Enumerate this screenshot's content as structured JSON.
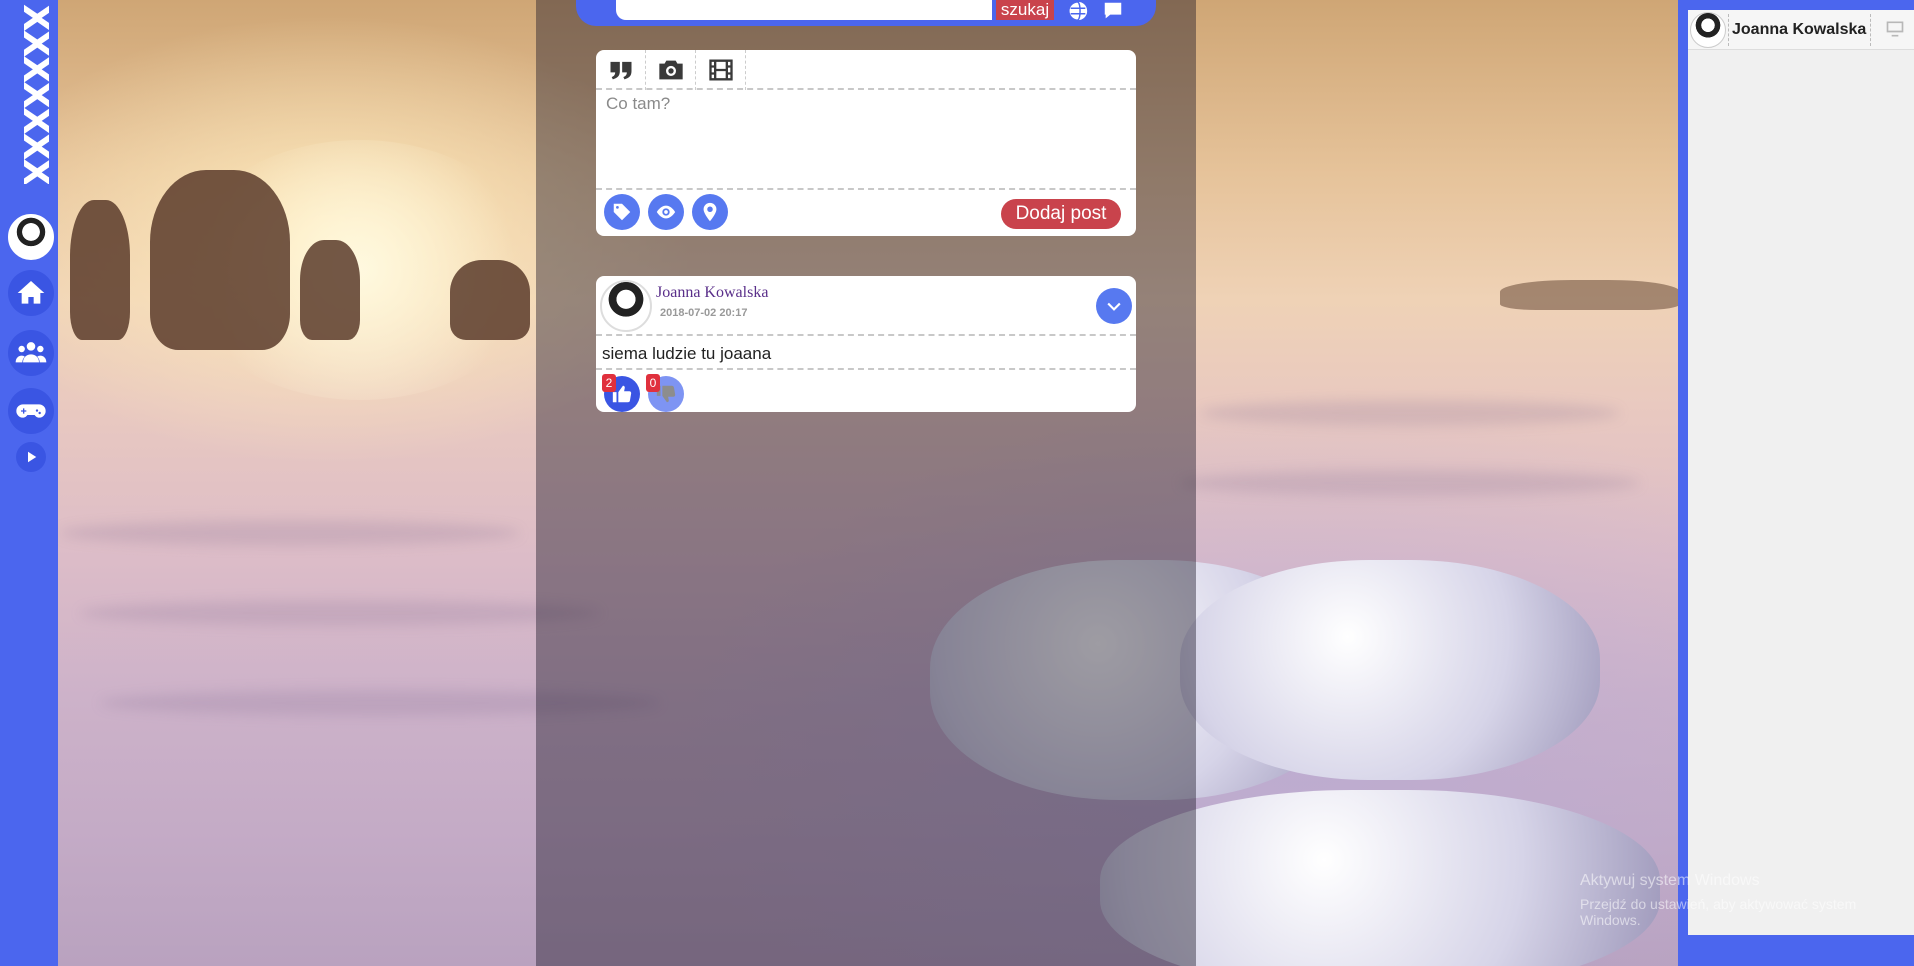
{
  "app": {
    "logo_text": "XXXXXXX"
  },
  "colors": {
    "brand_blue": "#4b66ee",
    "accent_red": "#c9434c",
    "button_blue": "#5779f0"
  },
  "left_nav": {
    "items": [
      {
        "name": "home",
        "icon": "home-icon"
      },
      {
        "name": "friends",
        "icon": "users-icon"
      },
      {
        "name": "games",
        "icon": "gamepad-icon"
      }
    ],
    "expand_icon": "play-icon"
  },
  "search": {
    "value": "",
    "placeholder": "",
    "button_label": "szukaj"
  },
  "composer": {
    "tabs": [
      {
        "name": "quote",
        "icon": "quote-icon"
      },
      {
        "name": "photo",
        "icon": "camera-icon"
      },
      {
        "name": "video",
        "icon": "film-icon"
      }
    ],
    "placeholder": "Co tam?",
    "value": "",
    "footer_icons": [
      "tag-icon",
      "eye-icon",
      "location-icon"
    ],
    "submit_label": "Dodaj post"
  },
  "post": {
    "author": "Joanna Kowalska",
    "date": "2018-07-02 20:17",
    "body": "siema ludzie tu joaana",
    "likes": "2",
    "dislikes": "0"
  },
  "contacts": [
    {
      "name": "Joanna Kowalska"
    }
  ],
  "watermark": {
    "line1": "Aktywuj system Windows",
    "line2": "Przejdź do ustawień, aby aktywować system Windows."
  }
}
